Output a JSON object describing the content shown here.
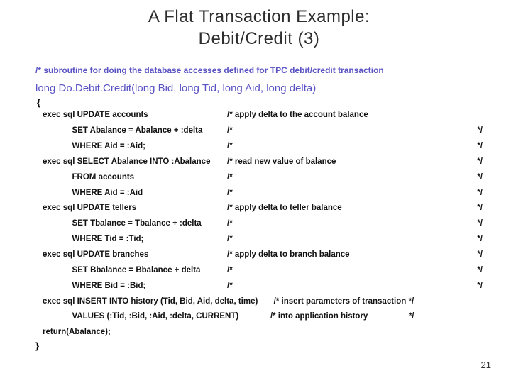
{
  "title_line1": "A Flat Transaction Example:",
  "title_line2": "Debit/Credit (3)",
  "subtitle": "/* subroutine for doing the database accesses defined for TPC debit/credit transaction",
  "signature": "long   Do.Debit.Credit(long Bid, long Tid, long Aid, long delta)",
  "open_brace": "{",
  "rows": [
    {
      "l": "exec sql UPDATE accounts",
      "m": "/* apply delta to the account balance",
      "r": ""
    },
    {
      "l": "             SET Abalance = Abalance + :delta",
      "m": "/*",
      "r": "*/"
    },
    {
      "l": "             WHERE Aid = :Aid;",
      "m": "/*",
      "r": "*/"
    },
    {
      "l": "exec sql SELECT Abalance INTO :Abalance",
      "m": "/* read new value of balance",
      "r": "*/"
    },
    {
      "l": "             FROM accounts",
      "m": "/*",
      "r": "*/"
    },
    {
      "l": "             WHERE Aid = :Aid",
      "m": "/*",
      "r": "*/"
    },
    {
      "l": "exec sql UPDATE tellers",
      "m": "/* apply delta to teller balance",
      "r": "*/"
    },
    {
      "l": "             SET Tbalance = Tbalance + :delta",
      "m": "/*",
      "r": "*/"
    },
    {
      "l": "             WHERE Tid = :Tid;",
      "m": "/*",
      "r": "*/"
    },
    {
      "l": "exec sql UPDATE branches",
      "m": "/* apply delta to branch balance",
      "r": "*/"
    },
    {
      "l": "             SET Bbalance = Bbalance + delta",
      "m": "/*",
      "r": "*/"
    },
    {
      "l": "             WHERE Bid = :Bid;",
      "m": "/*",
      "r": "*/"
    }
  ],
  "line_insert": "exec sql INSERT INTO history (Tid, Bid, Aid, delta, time)       /* insert parameters of transaction */",
  "line_values": "             VALUES (:Tid, :Bid, :Aid, :delta, CURRENT)              /* into application history                  */",
  "return_line": "return(Abalance);",
  "close_brace": "}",
  "page_number": "21"
}
